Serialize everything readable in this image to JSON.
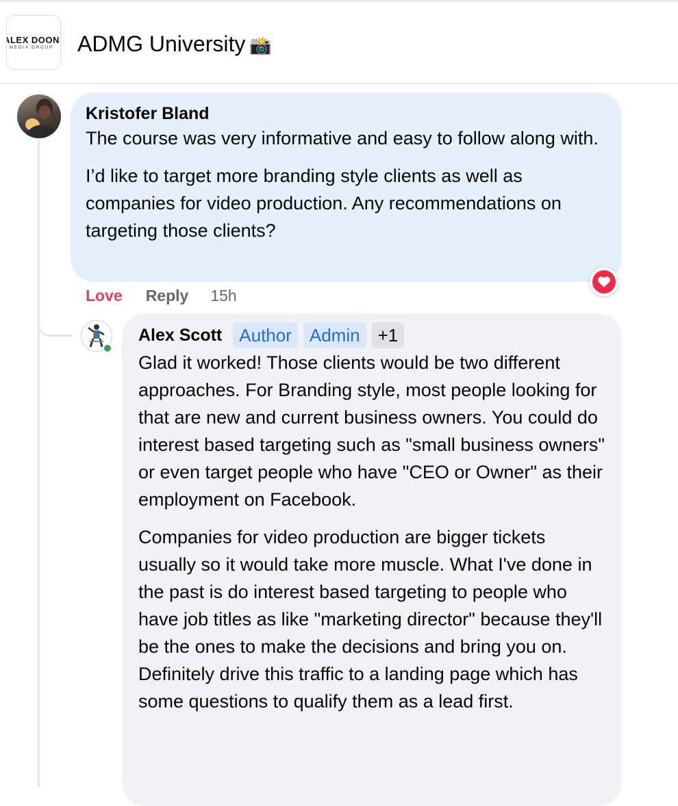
{
  "group": {
    "logo_text": "ALEX DOON",
    "logo_subtext": "MEDIA GROUP",
    "title": "ADMG University",
    "title_emoji": "📸"
  },
  "comment": {
    "author": "Kristofer Bland",
    "paragraphs": [
      "The course was very informative and easy to follow along with.",
      "I’d like to target more branding style clients as well as companies for video production. Any recommendations on targeting those clients?"
    ],
    "actions": {
      "love_label": "Love",
      "reply_label": "Reply",
      "timestamp": "15h"
    },
    "reaction": "heart"
  },
  "reply": {
    "author": "Alex Scott",
    "badges": [
      "Author",
      "Admin",
      "+1"
    ],
    "online": true,
    "paragraphs": [
      "Glad it worked! Those clients would be two different approaches. For Branding style, most people looking for that are new and current business owners. You could do interest based targeting such as \"small business owners\" or even target people who have \"CEO or Owner\" as their employment on Facebook.",
      "Companies for video production are bigger tickets usually so it would take more muscle. What I've done in the past is do interest based targeting to people who have job titles as like \"marketing director\" because they'll be the ones to make the decisions and bring you on. Definitely drive this traffic to a landing page which has some questions to qualify them as a lead first."
    ]
  },
  "colors": {
    "comment_bubble": "#e6f0fd",
    "reply_bubble": "#f0f2f5",
    "love": "#e4405f",
    "badge_text": "#1b6fd6",
    "online": "#31a24c"
  }
}
